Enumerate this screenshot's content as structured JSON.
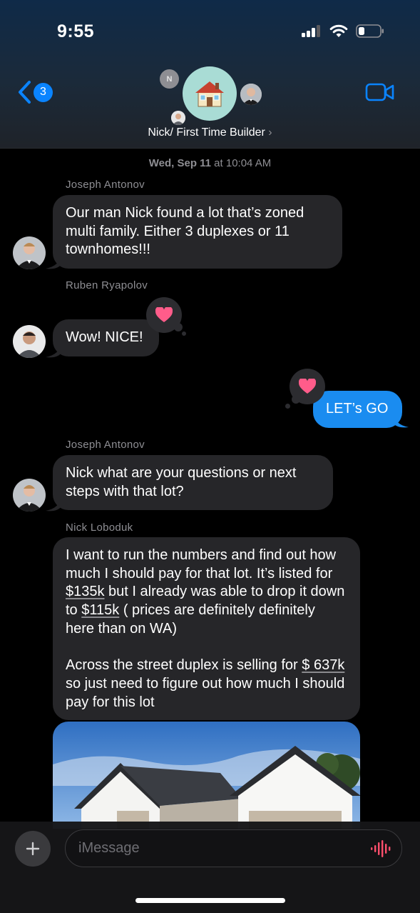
{
  "status_bar": {
    "time": "9:55"
  },
  "header": {
    "back_count": "3",
    "group_name": "Nick/ First Time Builder",
    "chevron": "›",
    "mini_initial": "N",
    "group_emoji": "🏠",
    "icons": [
      "chevron-left-icon",
      "video-camera-icon"
    ]
  },
  "conversation": {
    "timestamp_day": "Wed, Sep 11",
    "timestamp_time": " at 10:04 AM",
    "messages": [
      {
        "sender": "Joseph Antonov",
        "text": "Our man Nick found a lot that’s zoned multi family. Either 3 duplexes or 11 townhomes!!!"
      },
      {
        "sender": "Ruben Ryapolov",
        "text": "Wow! NICE!",
        "tapback": "♥"
      },
      {
        "sender": "me",
        "text": "LET’s GO",
        "tapback": "♥"
      },
      {
        "sender": "Joseph Antonov",
        "text": "Nick what are your questions or next steps with that lot?"
      },
      {
        "sender": "Nick Loboduk",
        "text_parts": {
          "p1": "I want to run the numbers and find out how much I should pay for that lot. It’s listed for ",
          "link1": "$135k",
          "p2": " but I already was able to drop it down to ",
          "link2": "$115k",
          "p3": " ( prices are definitely definitely here than on WA)",
          "p4": "Across the street duplex is selling for ",
          "link3": "$ 637k",
          "p5": " so just need to figure out how much I should pay for this lot"
        }
      }
    ]
  },
  "input": {
    "placeholder": "iMessage"
  },
  "colors": {
    "outgoing": "#1a8cf0",
    "incoming": "#262629",
    "heart": "#ff5c8a",
    "accent": "#0a84ff",
    "mic": "#ff4f6d"
  }
}
